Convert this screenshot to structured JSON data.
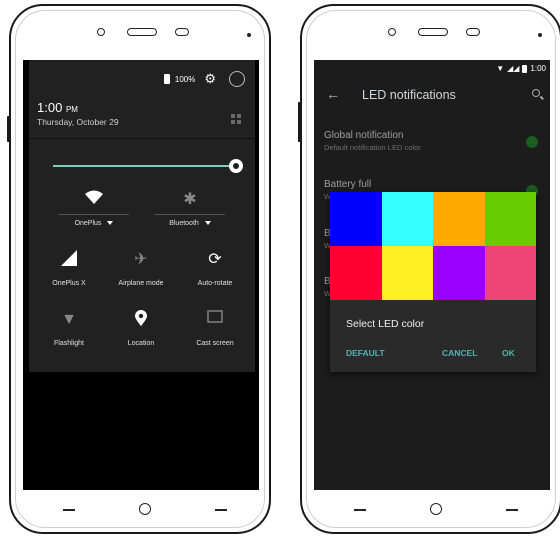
{
  "left_phone": {
    "status": {
      "battery_percent": "100%"
    },
    "clock": {
      "time": "1:00",
      "ampm": "PM",
      "date": "Thursday, October 29"
    },
    "brightness_level": 0.85,
    "tiles": [
      {
        "label": "OnePlus",
        "icon": "wifi-icon",
        "active": true
      },
      {
        "label": "Bluetooth",
        "icon": "bluetooth-off-icon",
        "active": false
      },
      {
        "label": "OnePlus X",
        "icon": "cell-signal-icon",
        "active": true
      },
      {
        "label": "Airplane mode",
        "icon": "airplane-icon",
        "active": false
      },
      {
        "label": "Auto-rotate",
        "icon": "auto-rotate-icon",
        "active": true
      },
      {
        "label": "Flashlight",
        "icon": "flashlight-off-icon",
        "active": false
      },
      {
        "label": "Location",
        "icon": "location-icon",
        "active": true
      },
      {
        "label": "Cast screen",
        "icon": "cast-icon",
        "active": false
      }
    ]
  },
  "right_phone": {
    "status": {
      "time": "1:00"
    },
    "title": "LED notifications",
    "prefs": [
      {
        "title": "Global notification",
        "subtitle": "Default notification LED color"
      },
      {
        "title": "Battery full",
        "subtitle": "W"
      },
      {
        "title": "B",
        "subtitle": "W"
      },
      {
        "title": "B",
        "subtitle": "W"
      }
    ],
    "dialog": {
      "title": "Select LED color",
      "colors": [
        "#0000ff",
        "#33ffff",
        "#ffaa00",
        "#66cc00",
        "#ff0033",
        "#ffee22",
        "#9900ff",
        "#ee4477"
      ],
      "buttons": {
        "default": "DEFAULT",
        "cancel": "CANCEL",
        "ok": "OK"
      }
    },
    "colors": {
      "accent": "#4db6ac",
      "led_dot": "#1b5e20"
    }
  }
}
